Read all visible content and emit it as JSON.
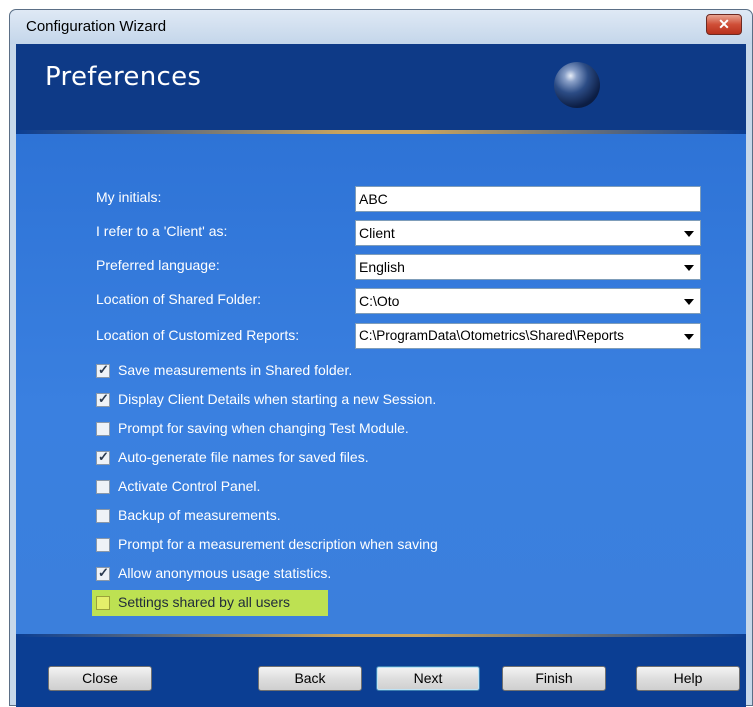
{
  "window": {
    "title": "Configuration Wizard",
    "close_glyph": "✕"
  },
  "header": {
    "title": "Preferences"
  },
  "fields": [
    {
      "label": "My initials:",
      "value": "ABC",
      "type": "text"
    },
    {
      "label": "I refer to a 'Client' as:",
      "value": "Client",
      "type": "dropdown"
    },
    {
      "label": "Preferred language:",
      "value": "English",
      "type": "dropdown"
    },
    {
      "label": "Location of Shared Folder:",
      "value": "C:\\Oto",
      "type": "dropdown"
    },
    {
      "label": "Location of Customized Reports:",
      "value": "C:\\ProgramData\\Otometrics\\Shared\\Reports",
      "type": "dropdown"
    }
  ],
  "checkboxes": [
    {
      "label": "Save measurements in Shared folder.",
      "checked": true
    },
    {
      "label": "Display Client Details when starting a new Session.",
      "checked": true
    },
    {
      "label": "Prompt for saving when changing Test Module.",
      "checked": false
    },
    {
      "label": "Auto-generate file names for saved files.",
      "checked": true
    },
    {
      "label": "Activate Control Panel.",
      "checked": false
    },
    {
      "label": "Backup of measurements.",
      "checked": false
    },
    {
      "label": "Prompt for a measurement description when saving",
      "checked": false
    },
    {
      "label": "Allow anonymous usage statistics.",
      "checked": true
    },
    {
      "label": "Settings shared by all users",
      "checked": false,
      "highlighted": true
    }
  ],
  "buttons": {
    "close": "Close",
    "back": "Back",
    "next": "Next",
    "finish": "Finish",
    "help": "Help"
  },
  "colors": {
    "panel": "#3a80e0",
    "header": "#0e3a87",
    "highlight": "#d5f23a",
    "accent": "#c9a45f"
  }
}
